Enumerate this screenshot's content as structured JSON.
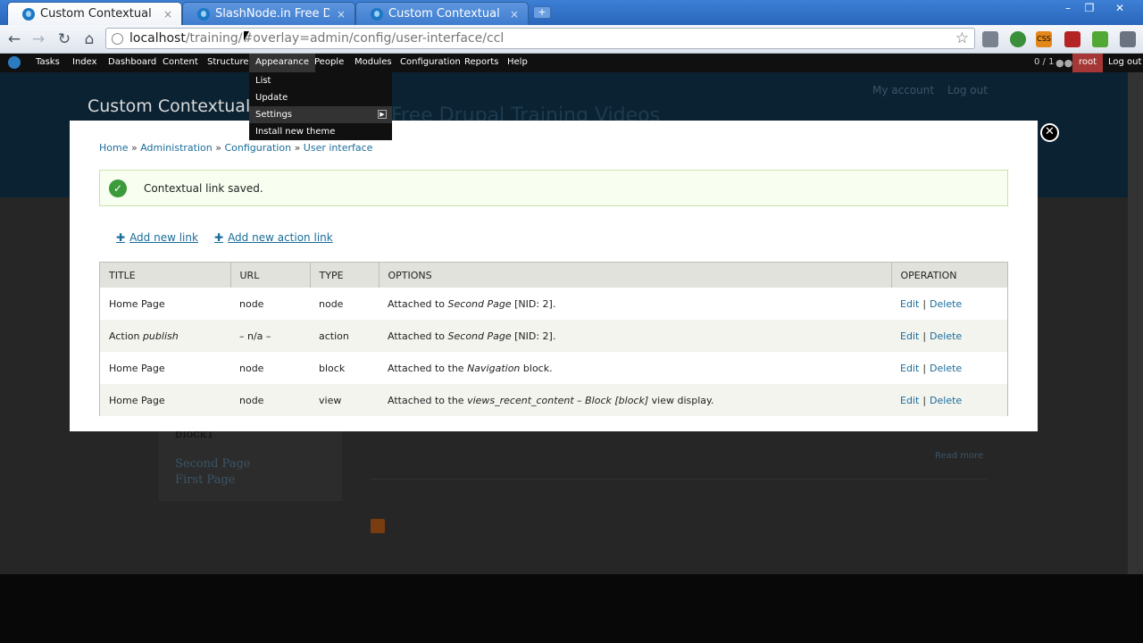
{
  "browser": {
    "tabs": [
      {
        "title": "Custom Contextual Lin...",
        "close": "×",
        "active": true
      },
      {
        "title": "SlashNode.in Free Dr...",
        "close": "×",
        "active": false
      },
      {
        "title": "Custom Contextual Lin...",
        "close": "×",
        "active": false
      }
    ],
    "new_tab": "+",
    "window_controls": [
      "–",
      "❐",
      "✕"
    ],
    "nav": {
      "back": "←",
      "forward": "→",
      "reload": "↻",
      "home": "⌂"
    },
    "url_host": "localhost",
    "url_path": "/training/#overlay=admin/config/user-interface/ccl",
    "star": "☆",
    "ext_css_label": "CSS"
  },
  "admin_menu": {
    "items": [
      "Tasks",
      "Index",
      "Dashboard",
      "Content",
      "Structure",
      "Appearance",
      "People",
      "Modules",
      "Configuration",
      "Reports",
      "Help"
    ],
    "counter": "0 / 1",
    "user": "root",
    "logout": "Log out"
  },
  "appearance_dropdown": {
    "items": [
      "List",
      "Update",
      "Settings",
      "Install new theme"
    ],
    "submenu_arrow": "▶"
  },
  "site": {
    "name": "Custom Contextual",
    "slogan": "Free Drupal Training Videos",
    "my_account": "My account",
    "log_out": "Log out",
    "block_label": "block1",
    "links": [
      "Second Page",
      "First Page"
    ],
    "read_more": "Read more"
  },
  "overlay": {
    "close": "✕",
    "breadcrumb": [
      "Home",
      "Administration",
      "Configuration",
      "User interface"
    ],
    "breadcrumb_sep": "»",
    "status_icon": "✓",
    "status_text": "Contextual link saved.",
    "add_new_link": "Add new link",
    "add_new_action_link": "Add new action link",
    "plus": "✚",
    "table": {
      "headers": [
        "TITLE",
        "URL",
        "TYPE",
        "OPTIONS",
        "OPERATION"
      ],
      "rows": [
        {
          "title": "Home Page",
          "title_em": "",
          "url": "node",
          "type": "node",
          "opt_pre": "Attached to ",
          "opt_em": "Second Page",
          "opt_post": " [NID: 2].",
          "edit": "Edit",
          "delete": "Delete"
        },
        {
          "title": "Action ",
          "title_em": "publish",
          "url": "– n/a –",
          "type": "action",
          "opt_pre": "Attached to ",
          "opt_em": "Second Page",
          "opt_post": " [NID: 2].",
          "edit": "Edit",
          "delete": "Delete"
        },
        {
          "title": "Home Page",
          "title_em": "",
          "url": "node",
          "type": "block",
          "opt_pre": "Attached to the ",
          "opt_em": "Navigation",
          "opt_post": " block.",
          "edit": "Edit",
          "delete": "Delete"
        },
        {
          "title": "Home Page",
          "title_em": "",
          "url": "node",
          "type": "view",
          "opt_pre": "Attached to the ",
          "opt_em": "views_recent_content – Block [block]",
          "opt_post": " view display.",
          "edit": "Edit",
          "delete": "Delete"
        }
      ],
      "op_sep": "|"
    }
  }
}
